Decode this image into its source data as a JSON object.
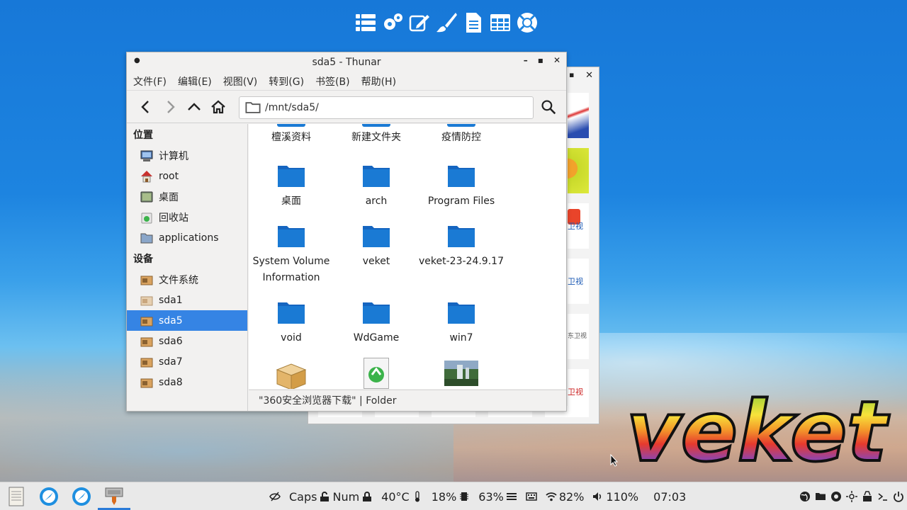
{
  "window": {
    "title": "sda5 - Thunar",
    "menu": [
      "文件(F)",
      "编辑(E)",
      "视图(V)",
      "转到(G)",
      "书签(B)",
      "帮助(H)"
    ],
    "path": "/mnt/sda5/"
  },
  "sidebar": {
    "places_title": "位置",
    "places": [
      "计算机",
      "root",
      "桌面",
      "回收站",
      "applications"
    ],
    "devices_title": "设备",
    "devices": [
      "文件系统",
      "sda1",
      "sda5",
      "sda6",
      "sda7",
      "sda8"
    ],
    "selected": "sda5"
  },
  "files": {
    "row0": [
      "檀溪资料",
      "新建文件夹",
      "疫情防控"
    ],
    "row1": [
      "桌面",
      "arch",
      "Program Files"
    ],
    "row2": [
      "System Volume Information",
      "veket",
      "veket-23-24.9.17"
    ],
    "row3": [
      "void",
      "WdGame",
      "win7"
    ]
  },
  "status": "\"360安全浏览器下载\" | Folder",
  "background_window": {
    "thumb_labels": [
      "卫视",
      "卫视",
      "东卫视",
      "卫视"
    ]
  },
  "taskbar": {
    "caps": "Caps",
    "num": "Num",
    "temp": "40°C",
    "cpu": "18%",
    "mem": "63%",
    "wifi": "82%",
    "volume": "110%",
    "clock": "07:03"
  },
  "logo": {
    "text": "veket"
  },
  "colors": {
    "accent": "#3584e4",
    "folder": "#1a7ad4",
    "desktop": "#1d84e0"
  }
}
